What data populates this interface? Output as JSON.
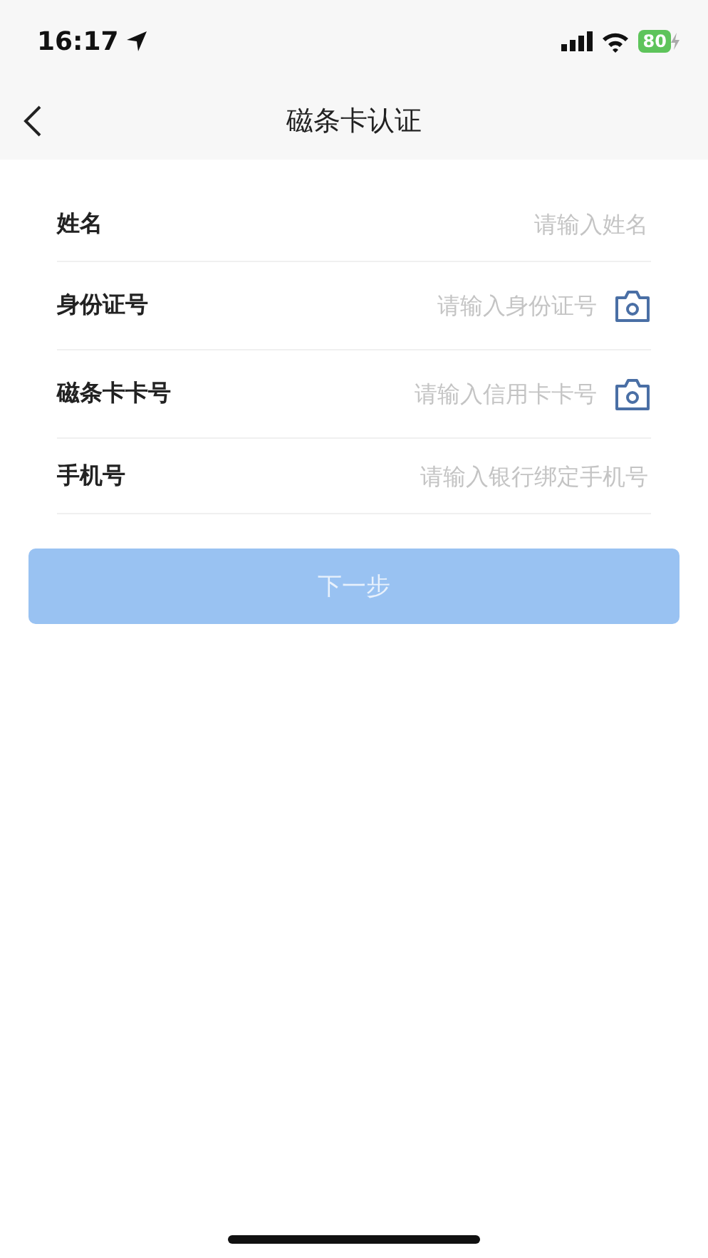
{
  "status_bar": {
    "time": "16:17",
    "battery": "80",
    "charging": true
  },
  "nav": {
    "title": "磁条卡认证"
  },
  "fields": [
    {
      "label": "姓名",
      "placeholder": "请输入姓名",
      "camera": false
    },
    {
      "label": "身份证号",
      "placeholder": "请输入身份证号",
      "camera": true
    },
    {
      "label": "磁条卡卡号",
      "placeholder": "请输入信用卡卡号",
      "camera": true
    },
    {
      "label": "手机号",
      "placeholder": "请输入银行绑定手机号",
      "camera": false
    }
  ],
  "next_button": {
    "label": "下一步",
    "disabled": true
  }
}
